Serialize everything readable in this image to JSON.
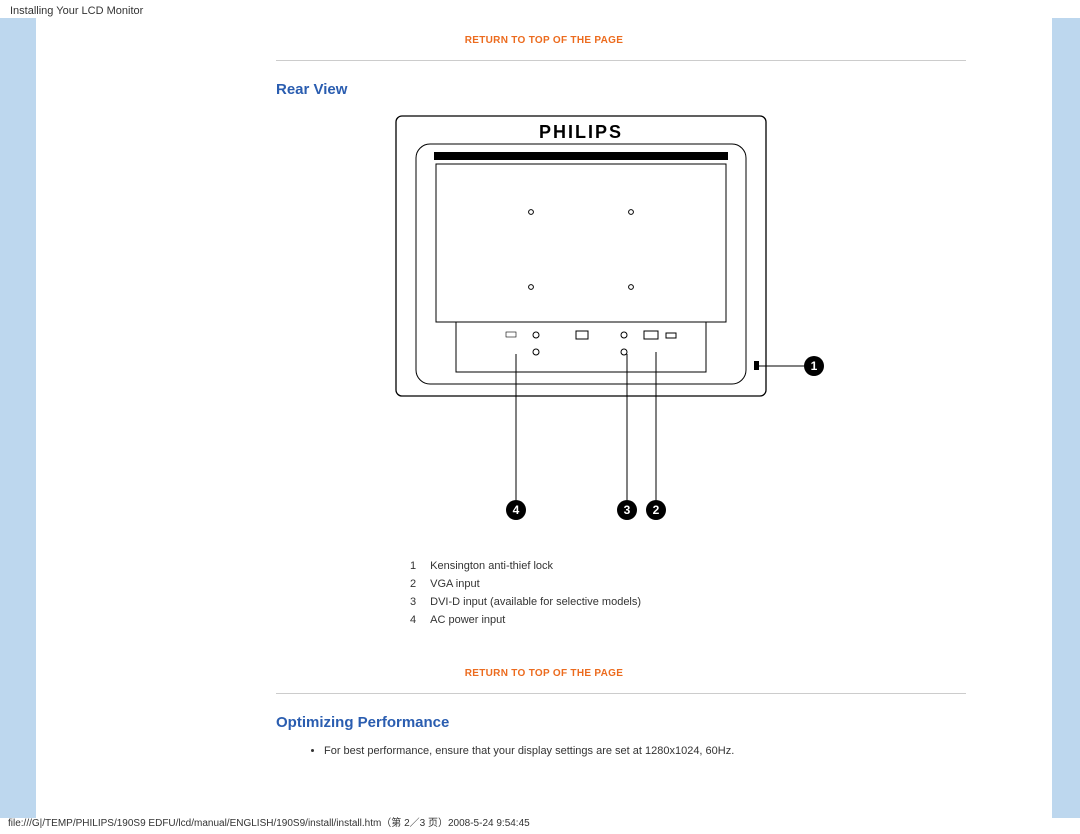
{
  "header_title": "Installing Your LCD Monitor",
  "return_link": "RETURN TO TOP OF THE PAGE",
  "sections": {
    "rear_view": "Rear View",
    "optimizing": "Optimizing Performance"
  },
  "brand": "PHILIPS",
  "legend": [
    {
      "num": "1",
      "desc": "Kensington anti-thief lock"
    },
    {
      "num": "2",
      "desc": "VGA input"
    },
    {
      "num": "3",
      "desc": "DVI-D input (available for selective models)"
    },
    {
      "num": "4",
      "desc": "AC power input"
    }
  ],
  "callouts": {
    "c1": "1",
    "c2": "2",
    "c3": "3",
    "c4": "4"
  },
  "performance_bullet": "For best performance, ensure that your display settings are set at 1280x1024, 60Hz.",
  "footer": "file:///G|/TEMP/PHILIPS/190S9 EDFU/lcd/manual/ENGLISH/190S9/install/install.htm（第 2／3 页）2008-5-24 9:54:45"
}
